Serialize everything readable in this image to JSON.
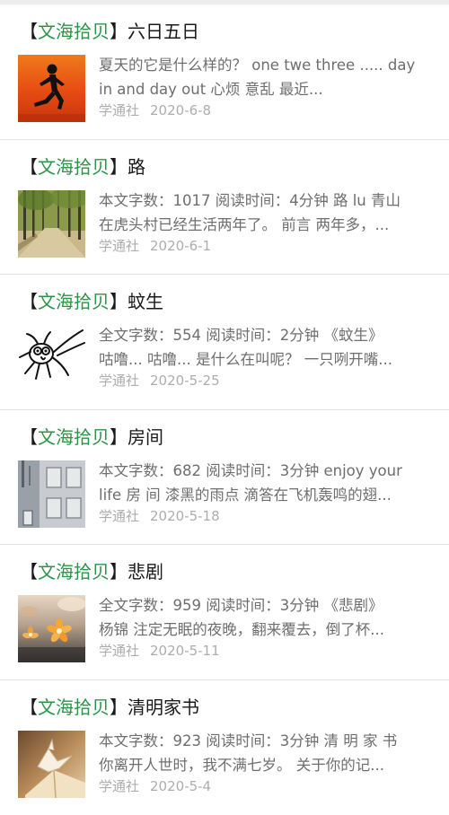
{
  "articles": [
    {
      "tag_open": "【",
      "tag": "文海拾贝",
      "tag_close": "】",
      "title": "六日五日",
      "snippet_line1": "夏天的它是什么样的？ one twe three ..... day",
      "snippet_line2": "in and day out 心烦 意乱 最近...",
      "source": "学通社",
      "date": "2020-6-8",
      "thumb_icon": "runner-silhouette-icon"
    },
    {
      "tag_open": "【",
      "tag": "文海拾贝",
      "tag_close": "】",
      "title": "路",
      "snippet_line1": "本文字数：1017 阅读时间：4分钟 路 lu 青山",
      "snippet_line2": "在虎头村已经生活两年了。 前言 两年多，...",
      "source": "学通社",
      "date": "2020-6-1",
      "thumb_icon": "forest-road-icon"
    },
    {
      "tag_open": "【",
      "tag": "文海拾贝",
      "tag_close": "】",
      "title": "蚊生",
      "snippet_line1": "全文字数：554 阅读时间：2分钟 《蚊生》",
      "snippet_line2": "咕噜... 咕噜... 是什么在叫呢？ 一只咧开嘴...",
      "source": "学通社",
      "date": "2020-5-25",
      "thumb_icon": "mosquito-cartoon-icon"
    },
    {
      "tag_open": "【",
      "tag": "文海拾贝",
      "tag_close": "】",
      "title": "房间",
      "snippet_line1": "本文字数：682 阅读时间：3分钟 enjoy your",
      "snippet_line2": "life 房 间 漆黑的雨点 滴答在飞机轰鸣的翅...",
      "source": "学通社",
      "date": "2020-5-18",
      "thumb_icon": "building-window-icon"
    },
    {
      "tag_open": "【",
      "tag": "文海拾贝",
      "tag_close": "】",
      "title": "悲剧",
      "snippet_line1": "全文字数：959 阅读时间：3分钟 《悲剧》",
      "snippet_line2": "杨锦 注定无眠的夜晚，翻来覆去，倒了杯...",
      "source": "学通社",
      "date": "2020-5-11",
      "thumb_icon": "fallen-flowers-icon"
    },
    {
      "tag_open": "【",
      "tag": "文海拾贝",
      "tag_close": "】",
      "title": "清明家书",
      "snippet_line1": "本文字数：923 阅读时间：3分钟 清 明 家 书",
      "snippet_line2": "你离开人世时，我不满七岁。 关于你的记...",
      "source": "学通社",
      "date": "2020-5-4",
      "thumb_icon": "paper-crane-book-icon"
    }
  ],
  "colors": {
    "tag_green": "#2b9447",
    "title": "#1a1a1a",
    "snippet": "#6e6e6e",
    "meta": "#adadad",
    "divider": "#e2e2e2"
  }
}
